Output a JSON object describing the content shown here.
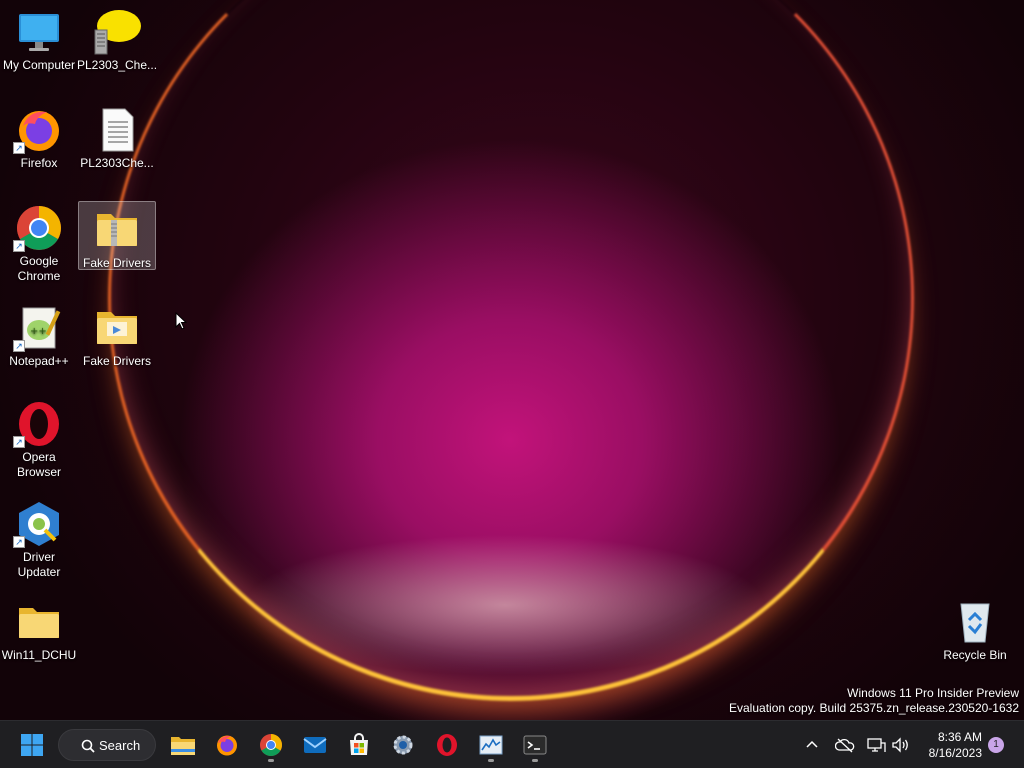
{
  "desktop": {
    "icons": [
      {
        "label": "My Computer"
      },
      {
        "label": "PL2303_Che..."
      },
      {
        "label": "Firefox"
      },
      {
        "label": "PL2303Che..."
      },
      {
        "label_line1": "Google",
        "label_line2": "Chrome"
      },
      {
        "label": "Fake Drivers"
      },
      {
        "label": "Notepad++"
      },
      {
        "label": "Fake Drivers"
      },
      {
        "label_line1": "Opera",
        "label_line2": "Browser"
      },
      {
        "label_line1": "Driver",
        "label_line2": "Updater"
      },
      {
        "label": "Win11_DCHU"
      },
      {
        "label": "Recycle Bin"
      }
    ]
  },
  "watermark": {
    "line1": "Windows 11 Pro Insider Preview",
    "line2": "Evaluation copy. Build 25375.zn_release.230520-1632"
  },
  "taskbar": {
    "search_label": "Search",
    "pinned": [
      "start-icon",
      "file-explorer-icon",
      "firefox-icon",
      "chrome-icon",
      "mail-icon",
      "store-icon",
      "settings-icon",
      "opera-icon",
      "task-manager-icon",
      "terminal-icon"
    ],
    "clock": {
      "time": "8:36 AM",
      "date": "8/16/2023"
    },
    "notification_count": "1"
  },
  "colors": {
    "taskbar_bg": "#1f1f22",
    "accent": "#0078d4",
    "wallpaper_core": "#c2137a"
  }
}
